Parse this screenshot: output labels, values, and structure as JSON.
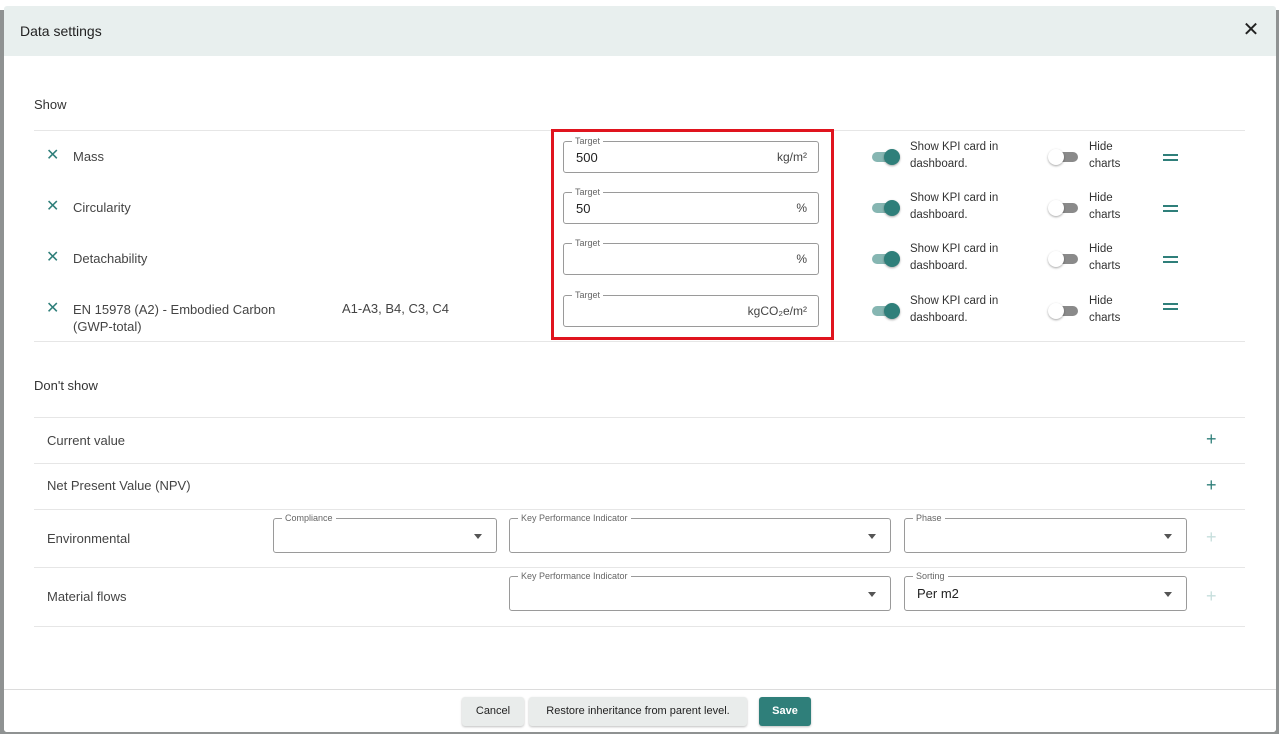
{
  "dialog": {
    "title": "Data settings"
  },
  "show_section": {
    "title": "Show",
    "kpis": [
      {
        "name": "Mass",
        "phase": "",
        "target_label": "Target",
        "target_value": "500",
        "unit": "kg/m²",
        "kpi_card_toggle": true,
        "kpi_card_label": "Show KPI card in dashboard.",
        "hide_charts_toggle": false,
        "hide_charts_label": "Hide charts"
      },
      {
        "name": "Circularity",
        "phase": "",
        "target_label": "Target",
        "target_value": "50",
        "unit": "%",
        "kpi_card_toggle": true,
        "kpi_card_label": "Show KPI card in dashboard.",
        "hide_charts_toggle": false,
        "hide_charts_label": "Hide charts"
      },
      {
        "name": "Detachability",
        "phase": "",
        "target_label": "Target",
        "target_value": "",
        "unit": "%",
        "kpi_card_toggle": true,
        "kpi_card_label": "Show KPI card in dashboard.",
        "hide_charts_toggle": false,
        "hide_charts_label": "Hide charts"
      },
      {
        "name": "EN 15978 (A2) - Embodied Carbon (GWP-total)",
        "phase": "A1-A3, B4, C3, C4",
        "target_label": "Target",
        "target_value": "",
        "unit": "kgCO₂e/m²",
        "kpi_card_toggle": true,
        "kpi_card_label": "Show KPI card in dashboard.",
        "hide_charts_toggle": false,
        "hide_charts_label": "Hide charts"
      }
    ]
  },
  "dont_show_section": {
    "title": "Don't show",
    "rows": [
      {
        "label": "Current value"
      },
      {
        "label": "Net Present Value (NPV)"
      }
    ],
    "environmental": {
      "label": "Environmental",
      "compliance_label": "Compliance",
      "compliance_value": "",
      "kpi_label": "Key Performance Indicator",
      "kpi_value": "",
      "phase_label": "Phase",
      "phase_value": ""
    },
    "material_flows": {
      "label": "Material flows",
      "kpi_label": "Key Performance Indicator",
      "kpi_value": "",
      "sorting_label": "Sorting",
      "sorting_value": "Per m2"
    }
  },
  "footer": {
    "cancel_label": "Cancel",
    "restore_label": "Restore inheritance from parent level.",
    "save_label": "Save"
  },
  "colors": {
    "accent": "#2f7f7a",
    "header_bg": "#e8efee",
    "highlight": "#e0141e"
  }
}
